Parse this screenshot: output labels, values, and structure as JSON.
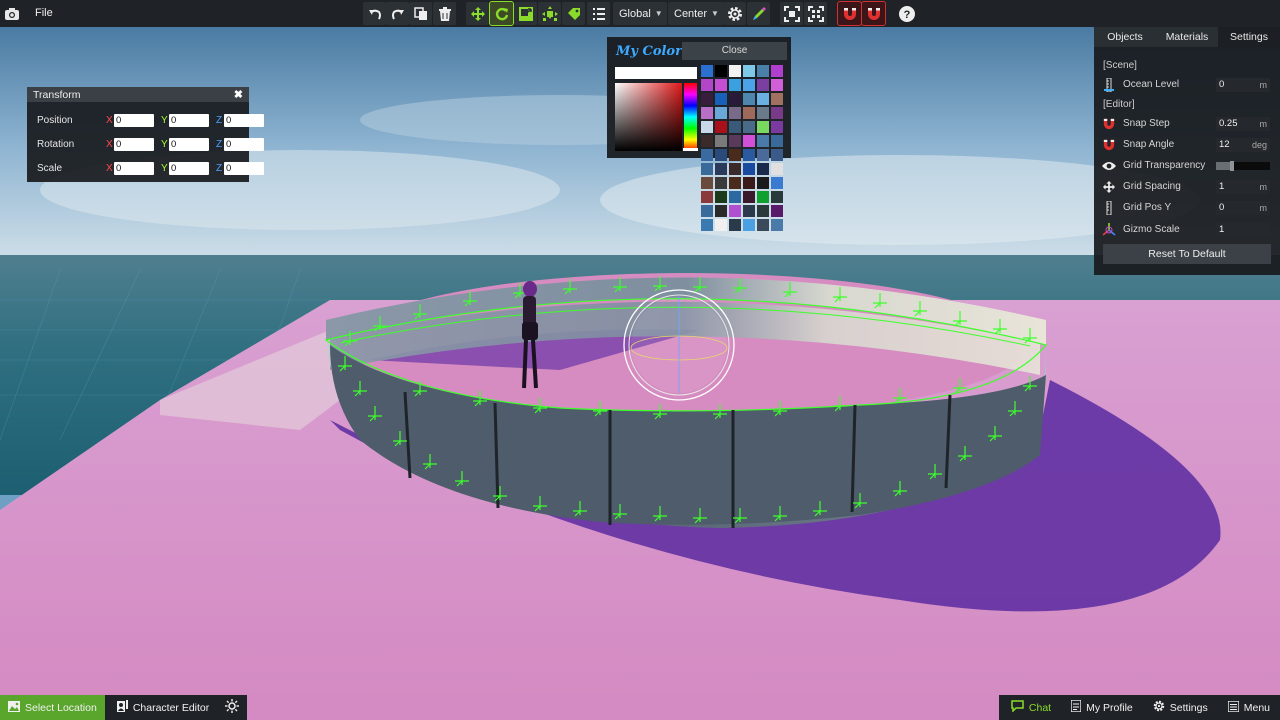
{
  "menu": {
    "file": "File"
  },
  "toolbar": {
    "space_mode": "Global",
    "pivot_mode": "Center"
  },
  "transform": {
    "title": "Transform",
    "axis_x": "X",
    "axis_y": "Y",
    "axis_z": "Z",
    "rows": [
      {
        "label": "Position",
        "x": "0",
        "y": "0",
        "z": "0"
      },
      {
        "label": "Rotation",
        "x": "0",
        "y": "0",
        "z": "0"
      },
      {
        "label": "Scale",
        "x": "0",
        "y": "0",
        "z": "0"
      }
    ]
  },
  "colors": {
    "title": "My Colors",
    "close": "Close",
    "swatches": [
      "#2b6fd1",
      "#000000",
      "#f2f2f2",
      "#7ec8e8",
      "#4a7fa8",
      "#b03fd0",
      "#b146c9",
      "#c44fd2",
      "#3aa0e0",
      "#4da3e8",
      "#7a3fa0",
      "#d05fd8",
      "#3a1d3d",
      "#1960b8",
      "#2a1a3a",
      "#4f86ad",
      "#6ab0e0",
      "#a07060",
      "#b86fc8",
      "#6aa8d8",
      "#7a6a8a",
      "#a06a5a",
      "#6a7a8a",
      "#7a3a8a",
      "#c8d8e8",
      "#a8101a",
      "#3a5a7a",
      "#4a6a8a",
      "#7ad860",
      "#7a3aa0",
      "#3a2a2a",
      "#7a7a7a",
      "#5a3a5a",
      "#d050d8",
      "#4a7aa8",
      "#3a6a9a",
      "#3a6aa0",
      "#2a4a7a",
      "#4a2a1a",
      "#2a5aa0",
      "#4a6a9a",
      "#3a5a8a",
      "#3a6a9a",
      "#2a3a5a",
      "#3a2a2a",
      "#1a4aa0",
      "#1a2a4a",
      "#e0e0e0",
      "#6a4a3a",
      "#3a3a3a",
      "#4a2a1a",
      "#3a1a1a",
      "#1a1a1a",
      "#3a7ad0",
      "#8a3a3a",
      "#1a3a1a",
      "#2a6aa0",
      "#3a1a2a",
      "#10a030",
      "#2a3a3a",
      "#3a6a9a",
      "#2a2a2a",
      "#b050d0",
      "#2a3a4a",
      "#2a3a3a",
      "#5a1a6a",
      "#3a7ab0",
      "#f0f0f0",
      "#2a3a4a",
      "#4aa0e0",
      "#3a4a5a",
      "#4a7aa8"
    ]
  },
  "settings": {
    "tabs": [
      "Objects",
      "Materials",
      "Settings"
    ],
    "active_tab": "Settings",
    "scene_label": "[Scene]",
    "editor_label": "[Editor]",
    "ocean_level": {
      "label": "Ocean Level",
      "value": "0",
      "unit": "m",
      "icon": "ruler-icon"
    },
    "snap_step": {
      "label": "Snap Step",
      "value": "0.25",
      "unit": "m",
      "icon": "magnet-icon"
    },
    "snap_angle": {
      "label": "Snap Angle",
      "value": "12",
      "unit": "deg",
      "icon": "magnet-icon"
    },
    "grid_transparency": {
      "label": "Grid Transparency",
      "value": 0.3,
      "icon": "eye-icon"
    },
    "grid_spacing": {
      "label": "Grid Spacing",
      "value": "1",
      "unit": "m",
      "icon": "move-icon"
    },
    "grid_pos_y": {
      "label": "Grid Pos Y",
      "value": "0",
      "unit": "m",
      "icon": "ruler-icon"
    },
    "gizmo_scale": {
      "label": "Gizmo Scale",
      "value": "1",
      "icon": "gizmo-icon"
    },
    "reset": "Reset To Default"
  },
  "bottom": {
    "select_location": "Select Location",
    "character_editor": "Character Editor",
    "chat": "Chat",
    "my_profile": "My Profile",
    "settings": "Settings",
    "menu": "Menu"
  },
  "colors_theme": {
    "accent_green": "#8bdc2a",
    "accent_red": "#d03030",
    "panel_bg": "#1f2327",
    "ground_pink": "#d892c8",
    "gizmo_green": "#3dff2a"
  }
}
